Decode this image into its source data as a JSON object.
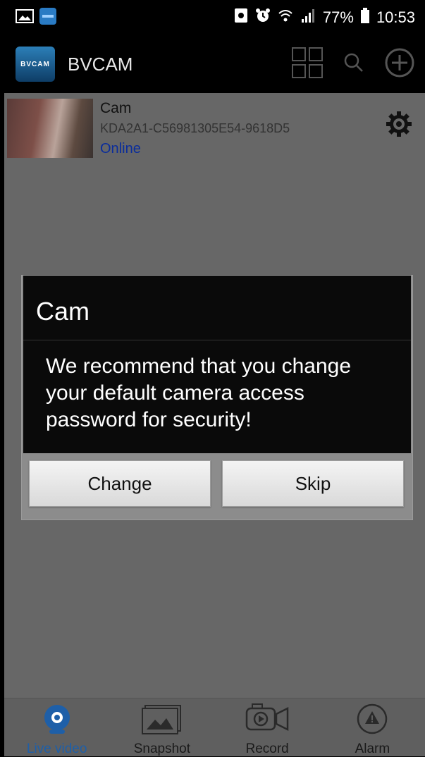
{
  "status_bar": {
    "battery": "77%",
    "time": "10:53"
  },
  "app_bar": {
    "logo_text": "BVCAM",
    "title": "BVCAM"
  },
  "device": {
    "name": "Cam",
    "id": "KDA2A1-C56981305E54-9618D5",
    "status": "Online"
  },
  "dialog": {
    "title": "Cam",
    "message": "We recommend that you change your default camera access password for security!",
    "change_label": "Change",
    "skip_label": "Skip"
  },
  "bottom_nav": {
    "items": [
      {
        "label": "Live video",
        "icon": "live-video-icon",
        "active": true
      },
      {
        "label": "Snapshot",
        "icon": "snapshot-icon",
        "active": false
      },
      {
        "label": "Record",
        "icon": "record-icon",
        "active": false
      },
      {
        "label": "Alarm",
        "icon": "alarm-icon",
        "active": false
      }
    ]
  },
  "colors": {
    "active": "#1e5fa8",
    "online": "#0b2d9b",
    "overlay": "#676767"
  }
}
